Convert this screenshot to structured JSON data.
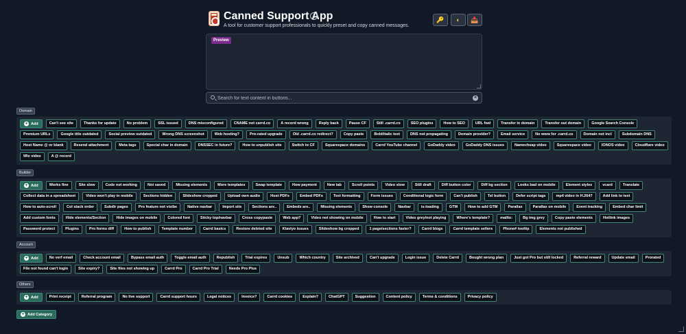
{
  "header": {
    "title": "Canned Support App",
    "subtitle": "A tool for customer support professionals to quickly preset and copy canned messages.",
    "tools": [
      {
        "name": "key-button",
        "icon": "🔑"
      },
      {
        "name": "theme-toggle-button",
        "icon": "◐"
      },
      {
        "name": "save-button",
        "icon": "📥"
      }
    ]
  },
  "preview": {
    "label": "Preview",
    "text": ""
  },
  "search": {
    "placeholder": "Search for text content in buttons...",
    "value": ""
  },
  "add_label": "Add",
  "add_category_label": "Add Category",
  "categories": [
    {
      "name": "Domain",
      "buttons": [
        "Can't see site",
        "Thanks for update",
        "No problem",
        "SSL issued",
        "DNS misconfigured",
        "CNAME not carrd.co",
        "A record wrong",
        "Reply back",
        "Pause CF",
        "Still .carrd.co",
        "SEO plugins",
        "How to SEO",
        "URL fwd",
        "Transfer in domain",
        "Transfer out domain",
        "Google Search Console",
        "Premium URLs",
        "Google title outdated",
        "Social preview outdated",
        "Wrong DNS screenshot",
        "Web hosting?",
        "Pro-rated upgrade",
        "Old .carrd.co redirect?",
        "Copy paste",
        "Bold/italic text",
        "DNS not propagating",
        "Domain provider?",
        "Email service",
        "No www for .carrd.co",
        "Domain not incl",
        "Subdomain DNS",
        "Host Name @ or blank",
        "Resend attachment",
        "Meta tags",
        "Special char in domain",
        "DNSSEC in future?",
        "How to unpublish site",
        "Switch to CF",
        "Squarespace domains",
        "Carrd YouTube channel",
        "GoDaddy video",
        "GoDaddy DNS issues",
        "Namecheap video",
        "Squarespace video",
        "IONOS video",
        "Cloudflare video",
        "Wix video",
        "A @ record"
      ]
    },
    {
      "name": "Builder",
      "buttons": [
        "Works fine",
        "Site slow",
        "Code not working",
        "Not saved",
        "Missing elements",
        "More templates",
        "Swap template",
        "How payment",
        "New tab",
        "Scroll points",
        "Video slow",
        "Still draft",
        "Diff button color",
        "Diff bg section",
        "Looks bad on mobile",
        "Element styles",
        "vcard",
        "Translate",
        "Collect data in a spreadsheet",
        "Video won't play in mobile",
        "Sections hidden",
        "Slideshow cropped",
        "Upload own audio",
        "Host PDFs",
        "Embed PDFs",
        "Text formatting",
        "Form issues",
        "Conditional logic form",
        "Can't publish",
        "Tel button",
        "Defer script tags",
        "mp4 video in H.264?",
        "Add link to text",
        "How to auto-scroll",
        "Col stack order",
        "Subdir pages",
        "Pro feature not visibe",
        "Native navbar",
        "Import site",
        "Sections are..",
        "Embeds are..",
        "Missing elements",
        "Show console",
        "Navbar",
        "is-loading",
        "GTM",
        "How to add GTM",
        "Parallax",
        "Parallax on mobile",
        "Event tracking",
        "Embed char limit",
        "Add custom fonts",
        "Hide elements/Section",
        "Hide images on mobile",
        "Colored font",
        "Sticky top/navbar",
        "Cross copypaste",
        "Web app?",
        "Video not showing on mobile",
        "How to start",
        "Video grey/not playing",
        "Where's template?",
        "mailto:",
        "Bg img grey",
        "Copy paste elements",
        "Hotlink images",
        "Password protect",
        "Plugins",
        "Pro forms diff",
        "How to publish",
        "Template number",
        "Carrd basics",
        "Restore deleted site",
        "Klaviyo issues",
        "Slideshow bg cropped",
        "1 page/sections faster?",
        "Carrd blogs",
        "Carrd template sellers",
        "Phone# tooltip",
        "Elements not published"
      ]
    },
    {
      "name": "Account",
      "buttons": [
        "No verf email",
        "Check account email",
        "Bypass email auth",
        "Toggle email auth",
        "Republish",
        "Trial expires",
        "Unsub",
        "Which country",
        "Site archived",
        "Can't upgrade",
        "Login issue",
        "Delete Carrd",
        "Bought wrong plan",
        "Just got Pro but still locked",
        "Referral reward",
        "Update email",
        "Prorated",
        "File not found can't login",
        "Site expiry?",
        "Site files not showing up",
        "Carrd Pro",
        "Carrd Pro Trial",
        "Needs Pro Plus"
      ]
    },
    {
      "name": "Others",
      "buttons": [
        "Print receipt",
        "Referral program",
        "No live support",
        "Carrd support hours",
        "Legal notices",
        "Invoice?",
        "Carrd cookies",
        "Explain?",
        "ChatGPT",
        "Suggestion",
        "Content policy",
        "Terms & conditions",
        "Privacy policy"
      ]
    }
  ],
  "colors": {
    "background": "#111826",
    "panel": "#1e2633",
    "chip_border": "#3f8a7a",
    "add_button": "#2b6b5c",
    "preview_badge": "#7b2d8b"
  }
}
